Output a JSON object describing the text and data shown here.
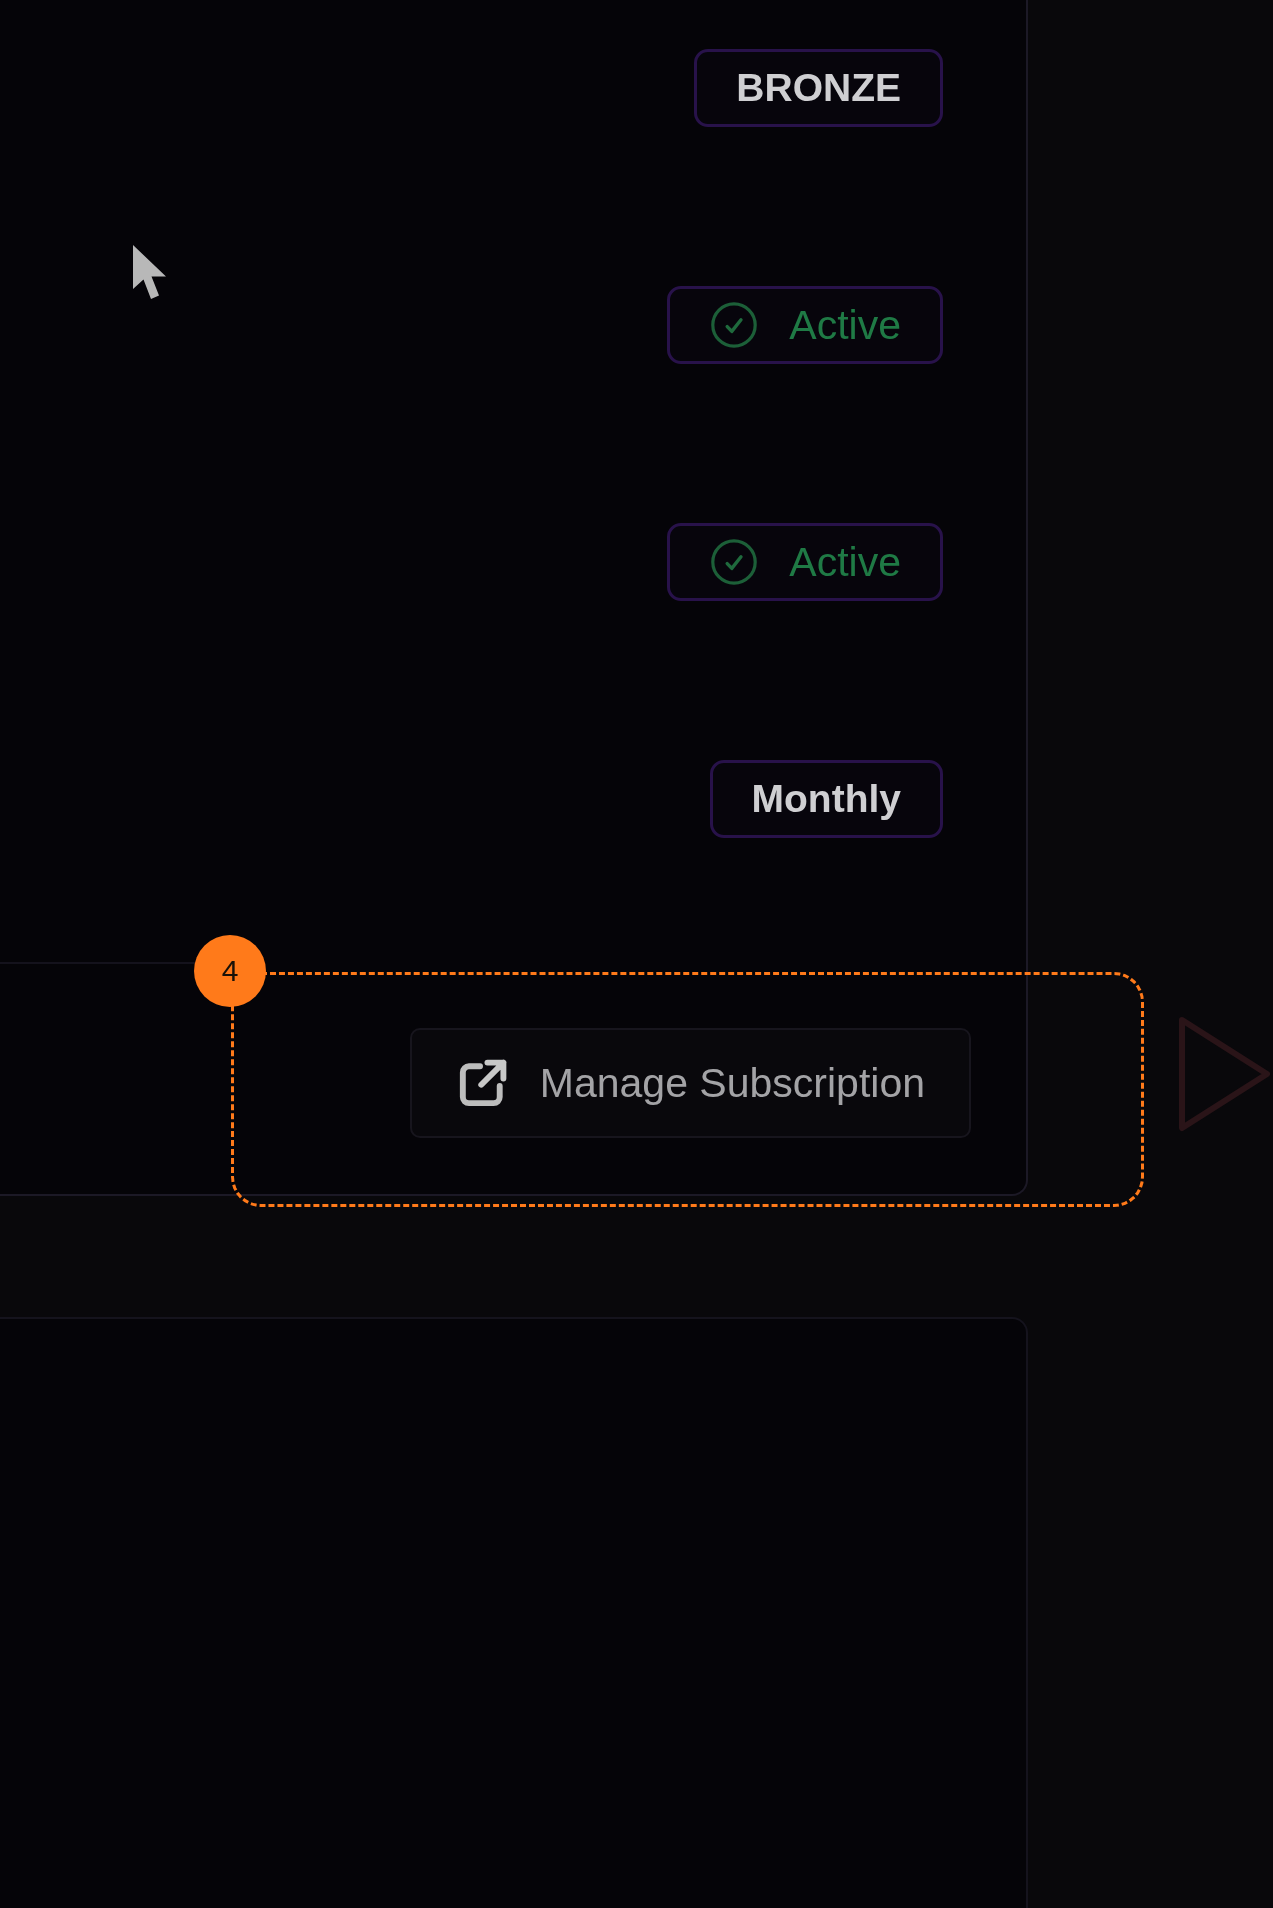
{
  "subscription_card": {
    "badges": [
      {
        "kind": "plain",
        "text": "BRONZE"
      },
      {
        "kind": "status",
        "text": "Active"
      },
      {
        "kind": "status",
        "text": "Active"
      },
      {
        "kind": "plain",
        "text": "Monthly"
      }
    ],
    "manage_button": {
      "label": "Manage Subscription"
    }
  },
  "annotation": {
    "number": "4"
  }
}
